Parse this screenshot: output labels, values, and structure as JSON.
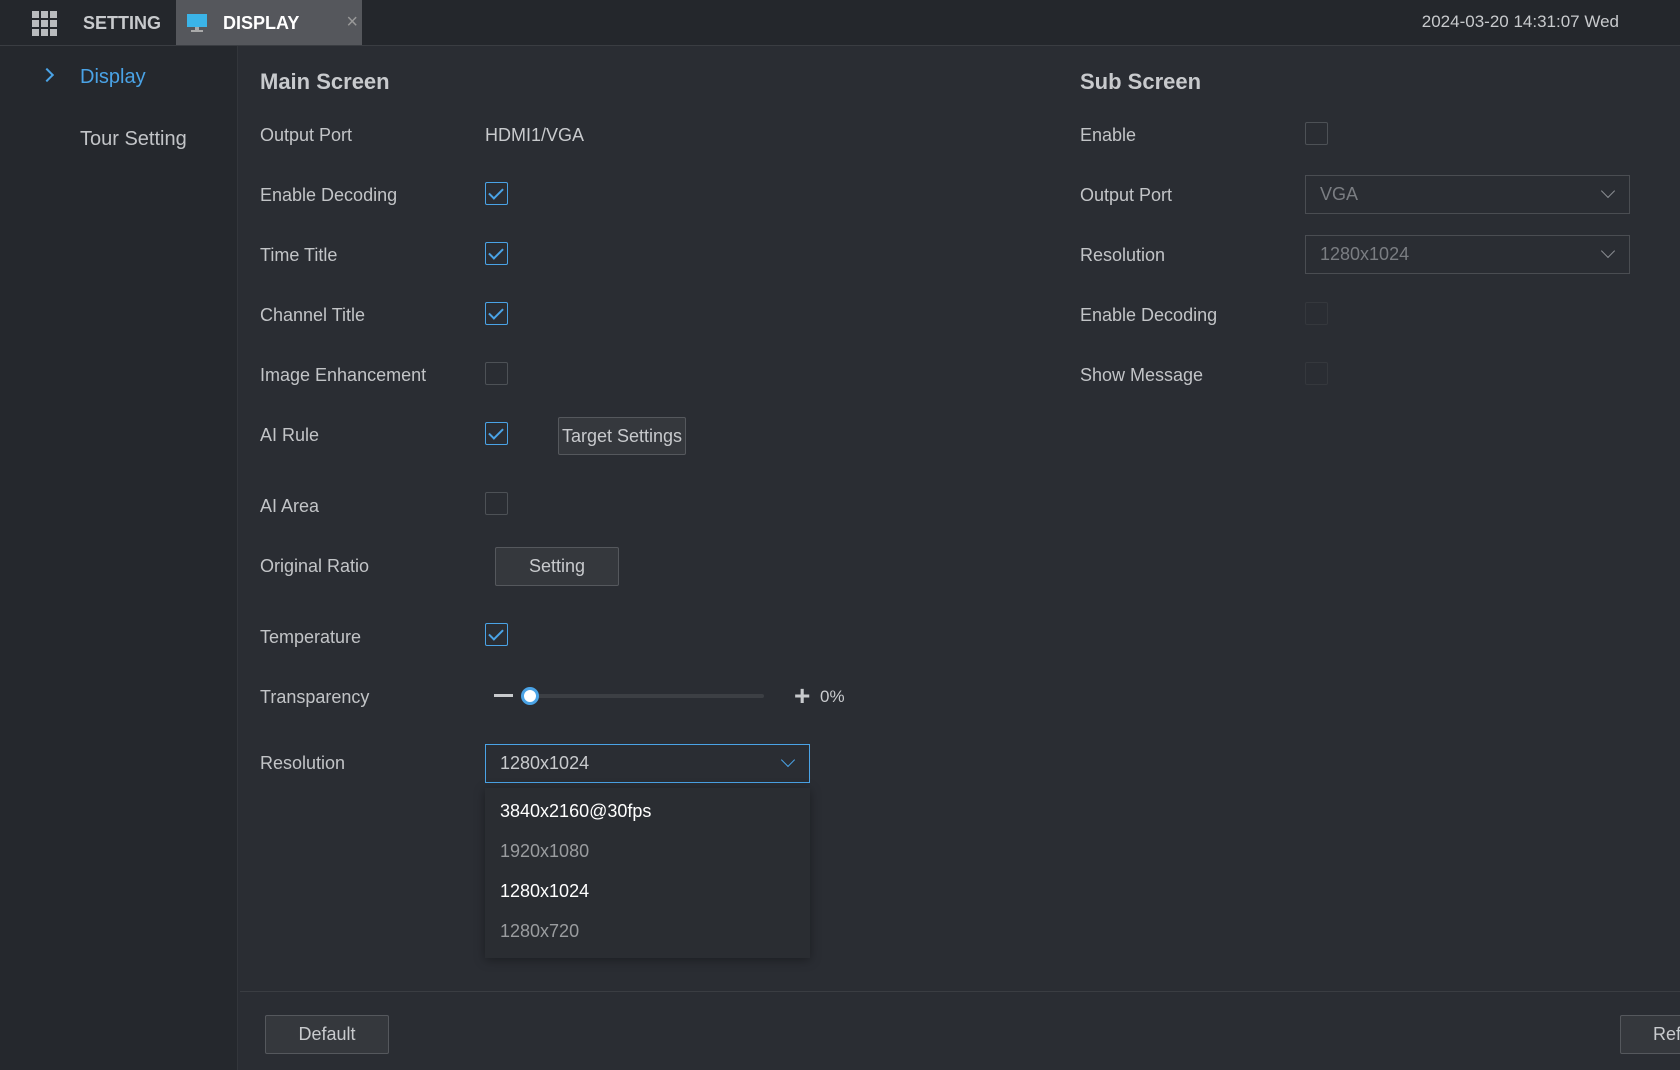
{
  "topbar": {
    "menu_icon": "grid-icon",
    "setting_label": "SETTING",
    "tab_label": "DISPLAY",
    "tab_icon": "monitor-icon",
    "close_icon": "close-icon",
    "datetime": "2024-03-20 14:31:07 Wed"
  },
  "sidebar": {
    "items": [
      {
        "label": "Display",
        "active": true
      },
      {
        "label": "Tour Setting",
        "active": false
      }
    ]
  },
  "main": {
    "title": "Main Screen",
    "output_port": {
      "label": "Output Port",
      "value": "HDMI1/VGA"
    },
    "enable_decoding": {
      "label": "Enable Decoding",
      "checked": true
    },
    "time_title": {
      "label": "Time Title",
      "checked": true
    },
    "channel_title": {
      "label": "Channel Title",
      "checked": true
    },
    "image_enhancement": {
      "label": "Image Enhancement",
      "checked": false
    },
    "ai_rule": {
      "label": "AI Rule",
      "checked": true,
      "button": "Target Settings"
    },
    "ai_area": {
      "label": "AI Area",
      "checked": false
    },
    "original_ratio": {
      "label": "Original Ratio",
      "button": "Setting"
    },
    "temperature": {
      "label": "Temperature",
      "checked": true
    },
    "transparency": {
      "label": "Transparency",
      "value": 0,
      "value_text": "0%"
    },
    "resolution": {
      "label": "Resolution",
      "value": "1280x1024",
      "options": [
        "3840x2160@30fps",
        "1920x1080",
        "1280x1024",
        "1280x720"
      ]
    }
  },
  "sub": {
    "title": "Sub Screen",
    "enable": {
      "label": "Enable",
      "checked": false
    },
    "output_port": {
      "label": "Output Port",
      "value": "VGA"
    },
    "resolution": {
      "label": "Resolution",
      "value": "1280x1024"
    },
    "enable_decoding": {
      "label": "Enable Decoding",
      "checked": false
    },
    "show_message": {
      "label": "Show Message",
      "checked": false
    }
  },
  "footer": {
    "default": "Default",
    "refresh": "Ref"
  },
  "colors": {
    "accent": "#4aa3e6",
    "background": "#2a2d33"
  }
}
